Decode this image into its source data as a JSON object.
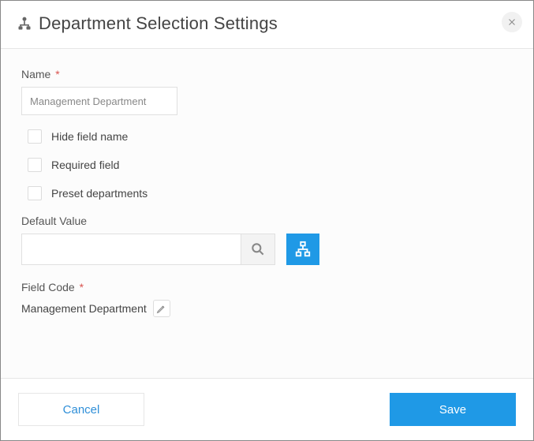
{
  "header": {
    "title": "Department Selection Settings"
  },
  "fields": {
    "name": {
      "label": "Name",
      "required_marker": "*",
      "value": "Management Department"
    },
    "hide_field_name": {
      "label": "Hide field name"
    },
    "required_field": {
      "label": "Required field"
    },
    "preset_departments": {
      "label": "Preset departments"
    },
    "default_value": {
      "label": "Default Value",
      "value": ""
    },
    "field_code": {
      "label": "Field Code",
      "required_marker": "*",
      "value": "Management Department"
    }
  },
  "footer": {
    "cancel": "Cancel",
    "save": "Save"
  }
}
